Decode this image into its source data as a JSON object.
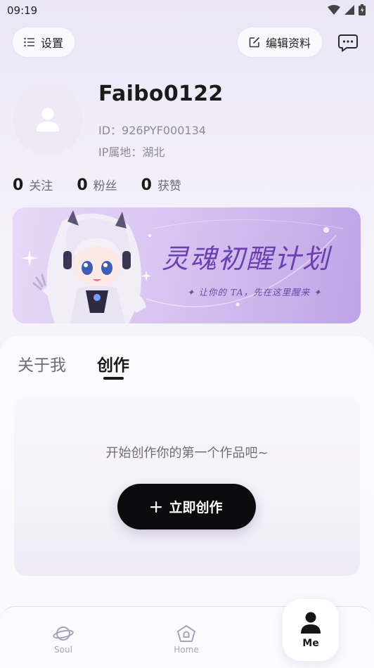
{
  "status": {
    "time": "09:19"
  },
  "header": {
    "settings_label": "设置",
    "edit_label": "编辑资料"
  },
  "profile": {
    "username": "Faibo0122",
    "id_line": "ID：926PYF000134",
    "ip_line": "IP属地：湖北"
  },
  "stats": [
    {
      "count": "0",
      "label": "关注"
    },
    {
      "count": "0",
      "label": "粉丝"
    },
    {
      "count": "0",
      "label": "获赞"
    }
  ],
  "banner": {
    "title": "灵魂初醒计划",
    "subtitle": "✦ 让你的 TA，先在这里醒来 ✦"
  },
  "tabs": [
    {
      "label": "关于我",
      "active": false
    },
    {
      "label": "创作",
      "active": true
    }
  ],
  "empty_state": {
    "message": "开始创作你的第一个作品吧~",
    "button_label": "立即创作"
  },
  "bottom_nav": [
    {
      "label": "Soul",
      "icon": "planet-icon",
      "active": false
    },
    {
      "label": "Home",
      "icon": "home-icon",
      "active": false
    },
    {
      "label": "Me",
      "icon": "person-icon",
      "active": true
    }
  ],
  "colors": {
    "accent_purple": "#6a3fb0",
    "primary_button": "#0b0b0d",
    "muted_text": "#8d8a96"
  }
}
